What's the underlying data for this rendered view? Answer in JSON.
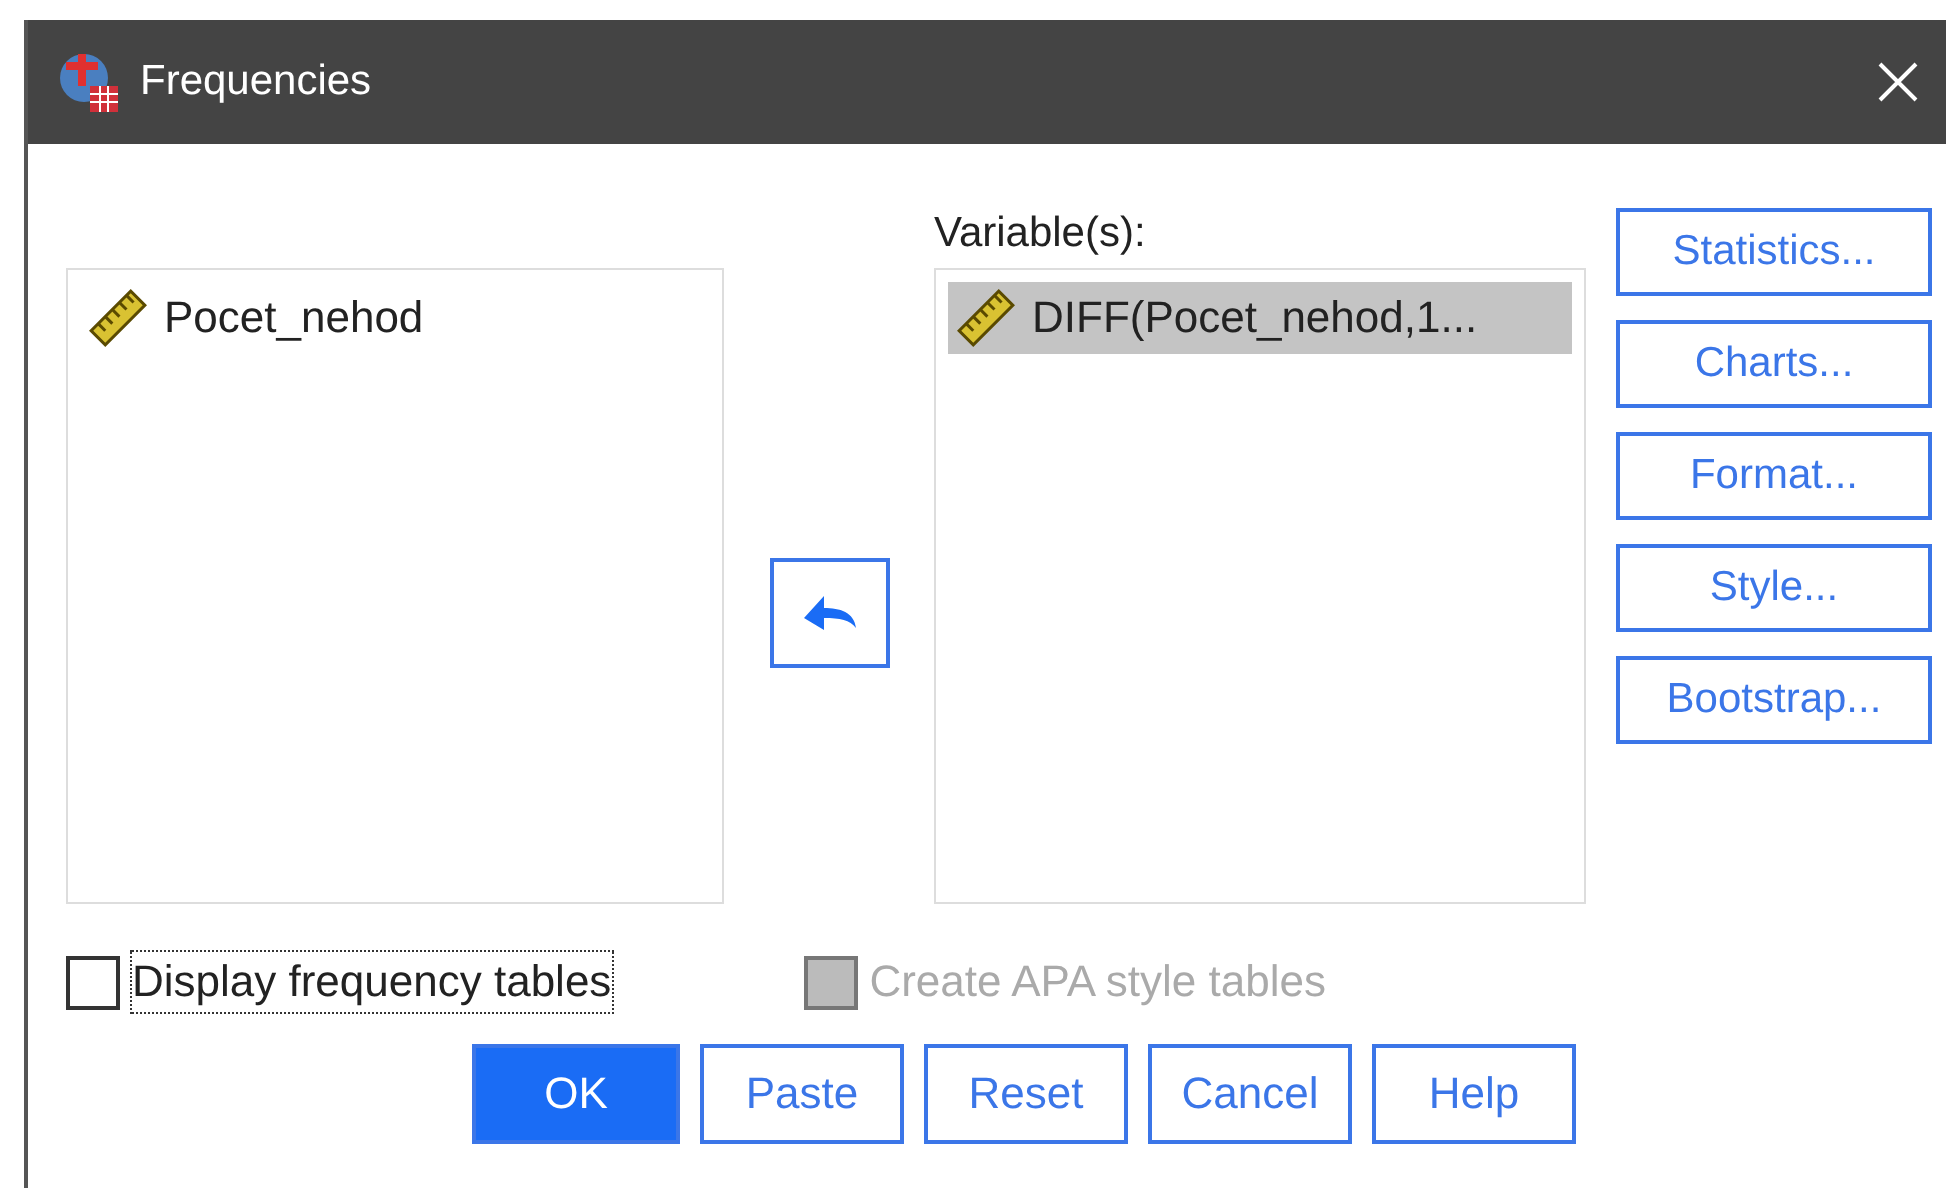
{
  "window": {
    "title": "Frequencies"
  },
  "source_list": {
    "items": [
      {
        "label": "Pocet_nehod",
        "selected": false
      }
    ]
  },
  "variables_label": {
    "text": "Variable(s):"
  },
  "variables_list": {
    "items": [
      {
        "label": "DIFF(Pocet_nehod,1...",
        "selected": true
      }
    ]
  },
  "side_buttons": [
    {
      "label": "Statistics..."
    },
    {
      "label": "Charts..."
    },
    {
      "label": "Format..."
    },
    {
      "label": "Style..."
    },
    {
      "label": "Bootstrap..."
    }
  ],
  "options": [
    {
      "label": "Display frequency tables",
      "checked": false,
      "disabled": false,
      "focused": true
    },
    {
      "label": "Create APA style tables",
      "checked": false,
      "disabled": true,
      "focused": false
    }
  ],
  "buttons": [
    {
      "label": "OK",
      "default": true
    },
    {
      "label": "Paste",
      "default": false
    },
    {
      "label": "Reset",
      "default": false
    },
    {
      "label": "Cancel",
      "default": false
    },
    {
      "label": "Help",
      "default": false
    }
  ]
}
